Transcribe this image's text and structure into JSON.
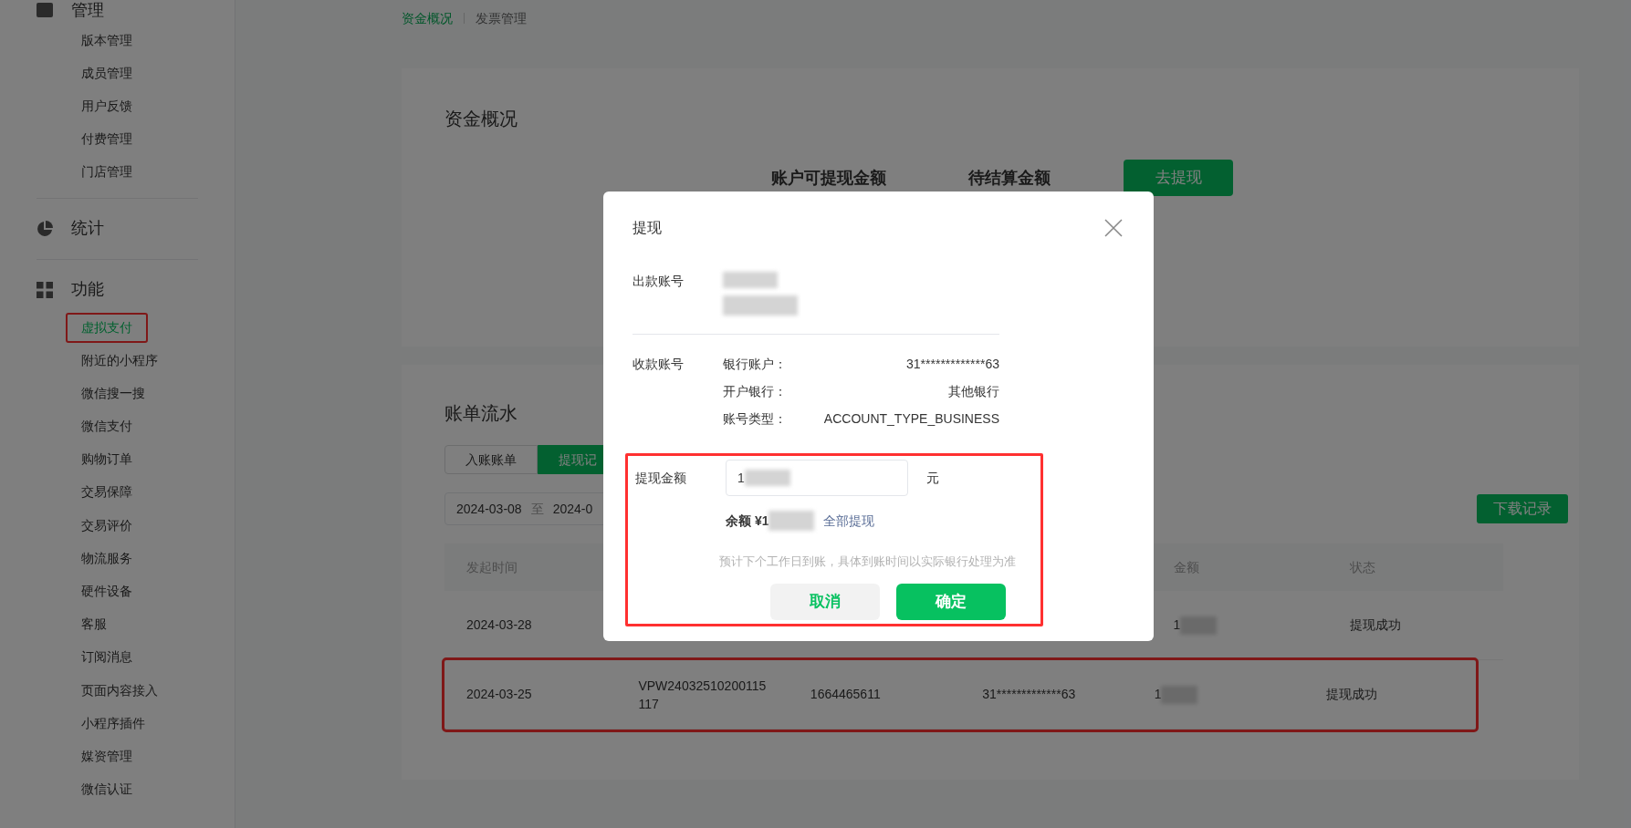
{
  "breadcrumb": [
    {
      "label": "资金概况",
      "selected": true
    },
    {
      "label": "发票管理",
      "selected": false
    }
  ],
  "sidebar": {
    "groups": [
      {
        "title": "管理",
        "items": [
          {
            "label": "版本管理",
            "selected": false,
            "highlighted": false
          },
          {
            "label": "成员管理",
            "selected": false,
            "highlighted": false
          },
          {
            "label": "用户反馈",
            "selected": false,
            "highlighted": false
          },
          {
            "label": "付费管理",
            "selected": false,
            "highlighted": false
          },
          {
            "label": "门店管理",
            "selected": false,
            "highlighted": false
          }
        ]
      },
      {
        "title": "统计"
      },
      {
        "title": "功能",
        "items": [
          {
            "label": "虚拟支付",
            "selected": true,
            "highlighted": true
          },
          {
            "label": "附近的小程序",
            "selected": false,
            "highlighted": false
          },
          {
            "label": "微信搜一搜",
            "selected": false,
            "highlighted": false
          },
          {
            "label": "微信支付",
            "selected": false,
            "highlighted": false
          },
          {
            "label": "购物订单",
            "selected": false,
            "highlighted": false
          },
          {
            "label": "交易保障",
            "selected": false,
            "highlighted": false
          },
          {
            "label": "交易评价",
            "selected": false,
            "highlighted": false
          },
          {
            "label": "物流服务",
            "selected": false,
            "highlighted": false
          },
          {
            "label": "硬件设备",
            "selected": false,
            "highlighted": false
          },
          {
            "label": "客服",
            "selected": false,
            "highlighted": false
          },
          {
            "label": "订阅消息",
            "selected": false,
            "highlighted": false
          },
          {
            "label": "页面内容接入",
            "selected": false,
            "highlighted": false
          },
          {
            "label": "小程序插件",
            "selected": false,
            "highlighted": false
          },
          {
            "label": "媒资管理",
            "selected": false,
            "highlighted": false
          },
          {
            "label": "微信认证",
            "selected": false,
            "highlighted": false
          }
        ]
      }
    ]
  },
  "overview": {
    "title": "资金概况",
    "metrics": [
      "账户可提现金额",
      "待结算金额"
    ],
    "button": "去提现"
  },
  "bills": {
    "title": "账单流水",
    "tabs": [
      {
        "label": "入账账单",
        "selected": false
      },
      {
        "label": "提现记",
        "selected": true
      }
    ],
    "date_range": {
      "start": "2024-03-08",
      "separator": "至",
      "end": "2024-0"
    },
    "download_button": "下载记录",
    "table": {
      "header": {
        "column_1": "发起时间",
        "column_5": "金额",
        "column_6": "状态"
      },
      "rows": [
        {
          "column_1": "2024-03-28",
          "column_5": "1",
          "column_6": "提现成功",
          "amount_redacted": true,
          "highlighted": false
        },
        {
          "column_1": "2024-03-25",
          "column_2": "VPW24032510200115117",
          "column_3": "1664465611",
          "column_4": "31*************63",
          "column_5": "1",
          "column_6": "提现成功",
          "amount_redacted": true,
          "highlighted": true
        }
      ]
    }
  },
  "modal": {
    "title": "提现",
    "payer_label": "出款账号",
    "payer_redacted": true,
    "payee_label": "收款账号",
    "payee_fields": [
      {
        "label": "银行账户：",
        "value": "31*************63"
      },
      {
        "label": "开户银行：",
        "value": "其他银行"
      },
      {
        "label": "账号类型：",
        "value": "ACCOUNT_TYPE_BUSINESS"
      }
    ],
    "amount_label": "提现金额",
    "amount_value": "1",
    "amount_redacted": true,
    "unit": "元",
    "balance": "余额 ¥1",
    "balance_redacted": true,
    "withdraw_all_link": "全部提现",
    "note": "预计下个工作日到账，具体到账时间以实际银行处理为准",
    "highlighted": true,
    "buttons": [
      {
        "label": "取消",
        "kind": "secondary"
      },
      {
        "label": "确定",
        "kind": "primary"
      }
    ]
  }
}
